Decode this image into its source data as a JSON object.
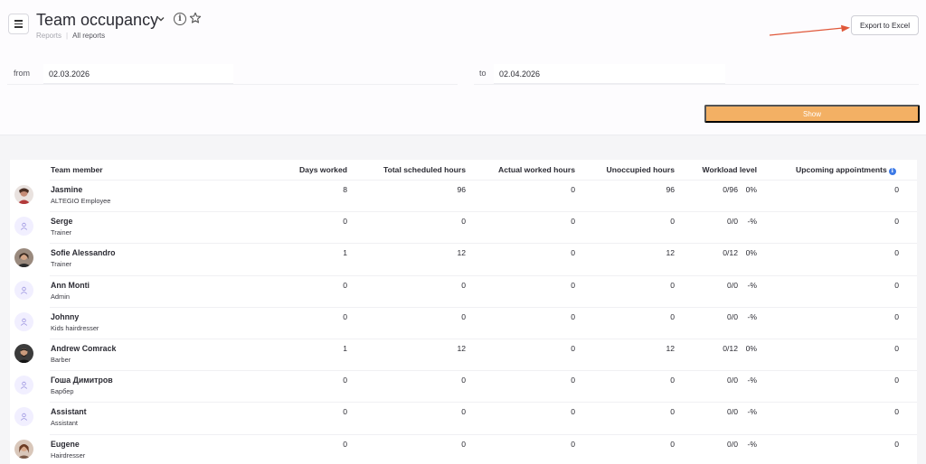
{
  "header": {
    "title": "Team occupancy",
    "breadcrumb_root": "Reports",
    "breadcrumb_current": "All reports",
    "export_label": "Export to Excel"
  },
  "filters": {
    "from_label": "from",
    "from_value": "02.03.2026",
    "to_label": "to",
    "to_value": "02.04.2026",
    "show_label": "Show"
  },
  "table": {
    "columns": {
      "member": "Team member",
      "days": "Days worked",
      "scheduled": "Total scheduled hours",
      "actual": "Actual worked hours",
      "unoccupied": "Unoccupied hours",
      "workload": "Workload level",
      "upcoming": "Upcoming appointments"
    },
    "rows": [
      {
        "name": "Jasmine",
        "role": "ALTEGIO Employee",
        "avatar": "photo-jasmine",
        "days": "8",
        "scheduled": "96",
        "actual": "0",
        "unoccupied": "96",
        "workload_hours": "0/96",
        "workload_pct": "0%",
        "upcoming": "0"
      },
      {
        "name": "Serge",
        "role": "Trainer",
        "avatar": "placeholder",
        "days": "0",
        "scheduled": "0",
        "actual": "0",
        "unoccupied": "0",
        "workload_hours": "0/0",
        "workload_pct": "-%",
        "upcoming": "0"
      },
      {
        "name": "Sofie Alessandro",
        "role": "Trainer",
        "avatar": "photo-sofie",
        "days": "1",
        "scheduled": "12",
        "actual": "0",
        "unoccupied": "12",
        "workload_hours": "0/12",
        "workload_pct": "0%",
        "upcoming": "0"
      },
      {
        "name": "Ann Monti",
        "role": "Admin",
        "avatar": "placeholder",
        "days": "0",
        "scheduled": "0",
        "actual": "0",
        "unoccupied": "0",
        "workload_hours": "0/0",
        "workload_pct": "-%",
        "upcoming": "0"
      },
      {
        "name": "Johnny",
        "role": "Kids hairdresser",
        "avatar": "placeholder",
        "days": "0",
        "scheduled": "0",
        "actual": "0",
        "unoccupied": "0",
        "workload_hours": "0/0",
        "workload_pct": "-%",
        "upcoming": "0"
      },
      {
        "name": "Andrew Comrack",
        "role": "Barber",
        "avatar": "photo-andrew",
        "days": "1",
        "scheduled": "12",
        "actual": "0",
        "unoccupied": "12",
        "workload_hours": "0/12",
        "workload_pct": "0%",
        "upcoming": "0"
      },
      {
        "name": "Гоша Димитров",
        "role": "Барбер",
        "avatar": "placeholder",
        "days": "0",
        "scheduled": "0",
        "actual": "0",
        "unoccupied": "0",
        "workload_hours": "0/0",
        "workload_pct": "-%",
        "upcoming": "0"
      },
      {
        "name": "Assistant",
        "role": "Assistant",
        "avatar": "placeholder",
        "days": "0",
        "scheduled": "0",
        "actual": "0",
        "unoccupied": "0",
        "workload_hours": "0/0",
        "workload_pct": "-%",
        "upcoming": "0"
      },
      {
        "name": "Eugene",
        "role": "Hairdresser",
        "avatar": "photo-eugene",
        "days": "0",
        "scheduled": "0",
        "actual": "0",
        "unoccupied": "0",
        "workload_hours": "0/0",
        "workload_pct": "-%",
        "upcoming": "0"
      }
    ]
  },
  "icons": {
    "menu": "hamburger-icon",
    "title_dropdown": "chevron-down-icon",
    "info": "info-icon",
    "favorite": "star-icon",
    "annotation_arrow": "arrow-icon",
    "avatar_placeholder": "user-icon"
  },
  "colors": {
    "show_button": "#f3b064",
    "annotation_arrow": "#e0583a",
    "info_badge": "#3d7ae6",
    "avatar_placeholder_bg": "#f1efff"
  }
}
